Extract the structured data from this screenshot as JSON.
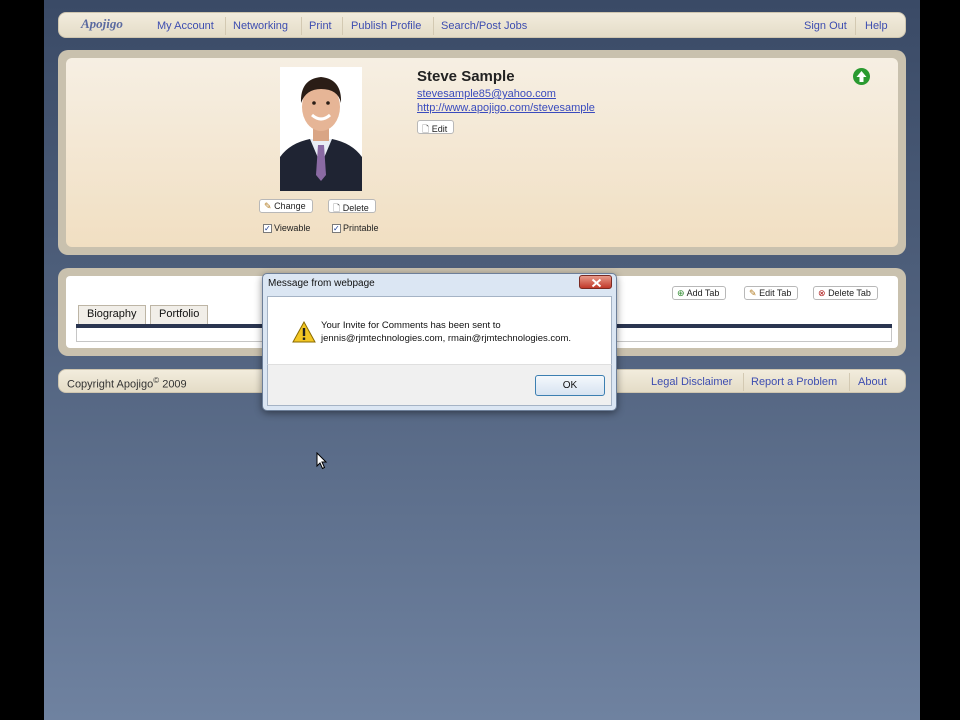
{
  "nav": {
    "logo": "Apojigo",
    "items": [
      "My Account",
      "Networking",
      "Print",
      "Publish Profile",
      "Search/Post Jobs"
    ],
    "right_items": [
      "Sign Out",
      "Help"
    ]
  },
  "profile": {
    "name": "Steve Sample",
    "email": "stevesample85@yahoo.com",
    "url": "http://www.apojigo.com/stevesample",
    "edit_label": "Edit",
    "change_label": "Change",
    "delete_label": "Delete",
    "viewable_label": "Viewable",
    "printable_label": "Printable",
    "viewable_checked": true,
    "printable_checked": true
  },
  "tabs": {
    "items": [
      "Biography",
      "Portfolio"
    ],
    "add_label": "Add Tab",
    "edit_label": "Edit Tab",
    "delete_label": "Delete Tab"
  },
  "footer": {
    "copyright_prefix": "Copyright Apojigo",
    "copyright_sup": "©",
    "copyright_year": " 2009",
    "links": [
      "Legal Disclaimer",
      "Report a Problem",
      "About"
    ]
  },
  "dialog": {
    "title": "Message from webpage",
    "message_line1": "Your Invite for Comments has been sent to",
    "message_line2": "jennis@rjmtechnologies.com, rmain@rjmtechnologies.com.",
    "ok_label": "OK"
  },
  "colors": {
    "link": "#3d4db0",
    "panel_border": "#c9c1ae",
    "background_top": "#3a4a66",
    "background_bottom": "#6f82a0"
  }
}
